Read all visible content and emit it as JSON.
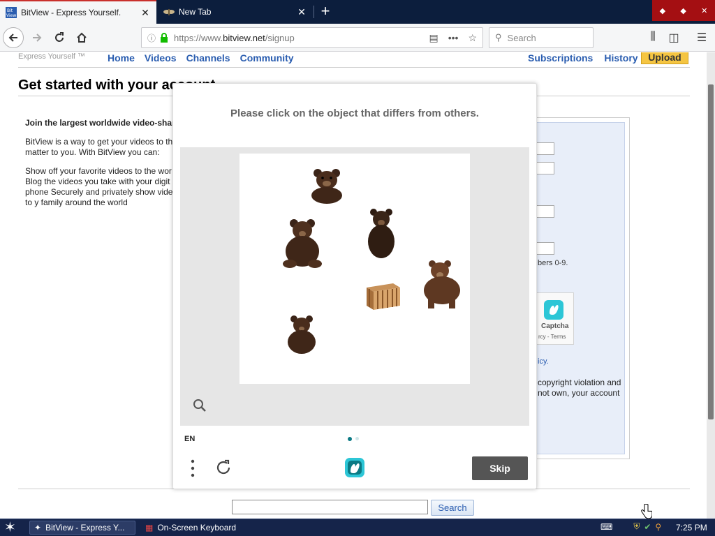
{
  "browser": {
    "tabs": [
      {
        "title": "BitView - Express Yourself.",
        "active": true
      },
      {
        "title": "New Tab",
        "active": false
      }
    ],
    "new_tab_label": "+",
    "url_scheme": "https://www.",
    "url_domain": "bitview.net",
    "url_path": "/signup",
    "search_placeholder": "Search"
  },
  "site": {
    "tagline": "Express Yourself ™",
    "nav": [
      "Home",
      "Videos",
      "Channels",
      "Community"
    ],
    "nav_right": [
      "Subscriptions",
      "History"
    ],
    "upload_label": "Upload",
    "page_title": "Get started with your account",
    "intro_heading": "Join the largest worldwide video-shar",
    "intro_p1": "BitView is a way to get your videos to th matter to you. With BitView you can:",
    "intro_p2": "Show off your favorite videos to the wor Blog the videos you take with your digit phone Securely and privately show videos to y family around the world",
    "form_hint": "bers 0-9.",
    "recaptcha_label": "Captcha",
    "recaptcha_terms": "rcy - Terms",
    "policy_link": "icy.",
    "copyright_text": "copyright violation and not own, your account",
    "footer_search_label": "Search"
  },
  "captcha": {
    "prompt": "Please click on the object that differs from others.",
    "language": "EN",
    "skip_label": "Skip",
    "objects": [
      "bear",
      "bear",
      "bear",
      "wooden-crate",
      "bear",
      "bear"
    ],
    "page_dots": 2,
    "current_page": 1
  },
  "taskbar": {
    "tasks": [
      "BitView - Express Y...",
      "On-Screen Keyboard"
    ],
    "clock": "7:25 PM"
  },
  "colors": {
    "tab_bar": "#0c1e3d",
    "link_blue": "#2a5db0",
    "upload_yellow": "#f5c542",
    "captcha_teal": "#0b7a84",
    "skip_button": "#555555"
  }
}
